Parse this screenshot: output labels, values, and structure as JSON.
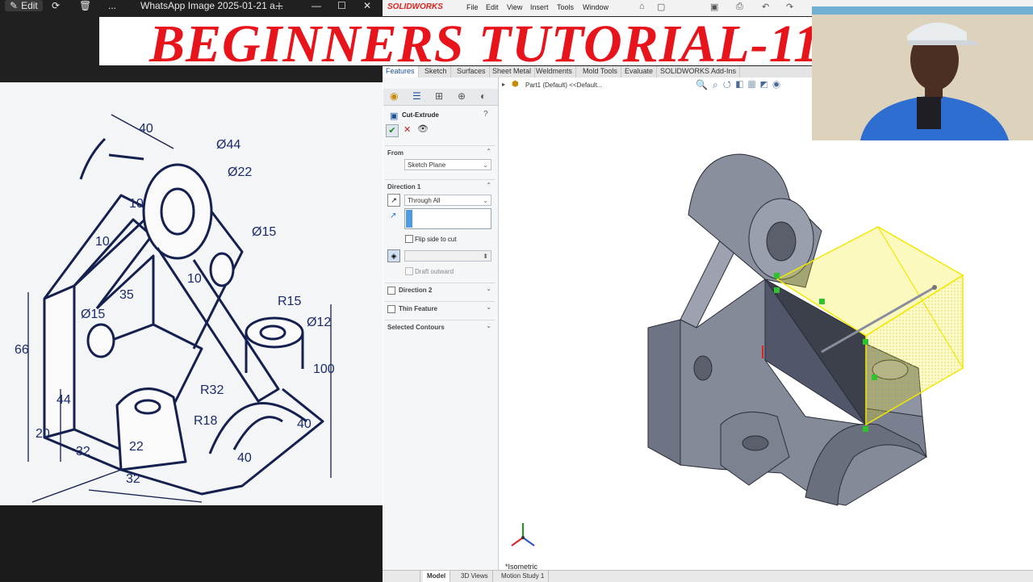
{
  "banner": {
    "title": "BEGINNERS TUTORIAL-11"
  },
  "viewer": {
    "edit_label": "Edit",
    "file_title": "WhatsApp Image 2025-01-21 a...",
    "more_label": "..."
  },
  "drawing": {
    "dims": [
      "40",
      "Ø44",
      "Ø22",
      "10",
      "10",
      "Ø15",
      "35",
      "Ø15",
      "10",
      "R15",
      "Ø12",
      "66",
      "44",
      "100",
      "R32",
      "R18",
      "22",
      "20",
      "32",
      "32",
      "40",
      "40"
    ]
  },
  "solidworks": {
    "brand": "SOLIDWORKS",
    "menus": [
      "File",
      "Edit",
      "View",
      "Insert",
      "Tools",
      "Window"
    ],
    "tabs": [
      "Features",
      "Sketch",
      "Surfaces",
      "Sheet Metal",
      "Weldments",
      "Mold Tools",
      "Evaluate",
      "SOLIDWORKS Add-Ins"
    ],
    "tree_item": "Part1 (Default) <<Default...",
    "property_manager": {
      "title": "Cut-Extrude",
      "from_label": "From",
      "from_value": "Sketch Plane",
      "direction1_label": "Direction 1",
      "direction1_value": "Through All",
      "flip_side_label": "Flip side to cut",
      "draft_outward_label": "Draft outward",
      "direction2_label": "Direction 2",
      "thin_feature_label": "Thin Feature",
      "selected_contours_label": "Selected Contours"
    },
    "view_label": "*Isometric",
    "bottom_tabs": [
      "",
      "Model",
      "3D Views",
      "Motion Study 1"
    ],
    "accent": "#1a4f9c",
    "preview_color": "#f2e800"
  }
}
